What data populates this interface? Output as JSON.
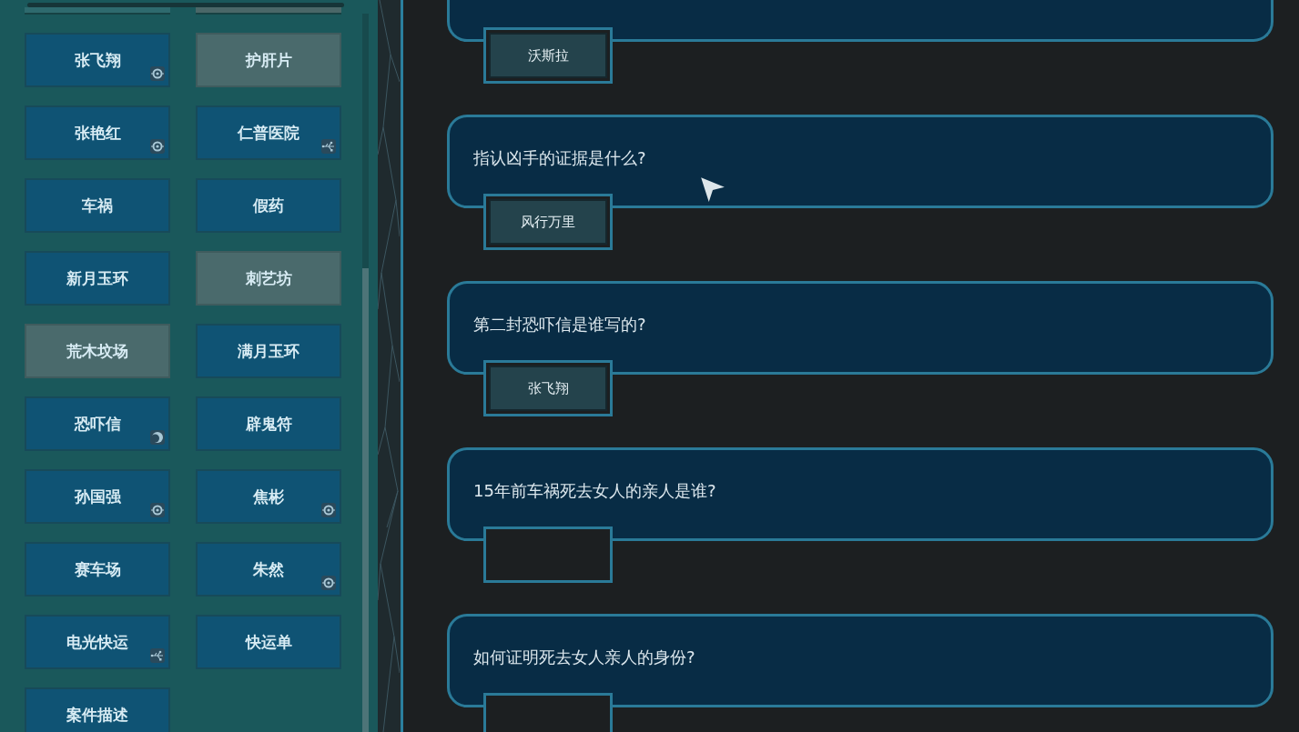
{
  "clues": [
    {
      "label": "张飞翔",
      "used": false,
      "kind": "eye"
    },
    {
      "label": "护肝片",
      "used": true,
      "kind": "plain"
    },
    {
      "label": "张艳红",
      "used": false,
      "kind": "eye"
    },
    {
      "label": "仁普医院",
      "used": false,
      "kind": "usb"
    },
    {
      "label": "车祸",
      "used": false,
      "kind": "plain"
    },
    {
      "label": "假药",
      "used": false,
      "kind": "plain"
    },
    {
      "label": "新月玉环",
      "used": false,
      "kind": "plain"
    },
    {
      "label": "刺艺坊",
      "used": true,
      "kind": "plain"
    },
    {
      "label": "荒木坟场",
      "used": true,
      "kind": "plain"
    },
    {
      "label": "满月玉环",
      "used": false,
      "kind": "plain"
    },
    {
      "label": "恐吓信",
      "used": false,
      "kind": "moon"
    },
    {
      "label": "辟鬼符",
      "used": false,
      "kind": "plain"
    },
    {
      "label": "孙国强",
      "used": false,
      "kind": "eye"
    },
    {
      "label": "焦彬",
      "used": false,
      "kind": "eye"
    },
    {
      "label": "赛车场",
      "used": false,
      "kind": "plain"
    },
    {
      "label": "朱然",
      "used": false,
      "kind": "eye"
    },
    {
      "label": "电光快运",
      "used": false,
      "kind": "usb"
    },
    {
      "label": "快运单",
      "used": false,
      "kind": "plain"
    },
    {
      "label": "案件描述",
      "used": false,
      "kind": "plain"
    }
  ],
  "questions": [
    {
      "answer": "沃斯拉"
    },
    {
      "text": "指认凶手的证据是什么?",
      "answer": "风行万里"
    },
    {
      "text": "第二封恐吓信是谁写的?",
      "answer": "张飞翔"
    },
    {
      "text": "15年前车祸死去女人的亲人是谁?"
    },
    {
      "text": "如何证明死去女人亲人的身份?"
    }
  ]
}
